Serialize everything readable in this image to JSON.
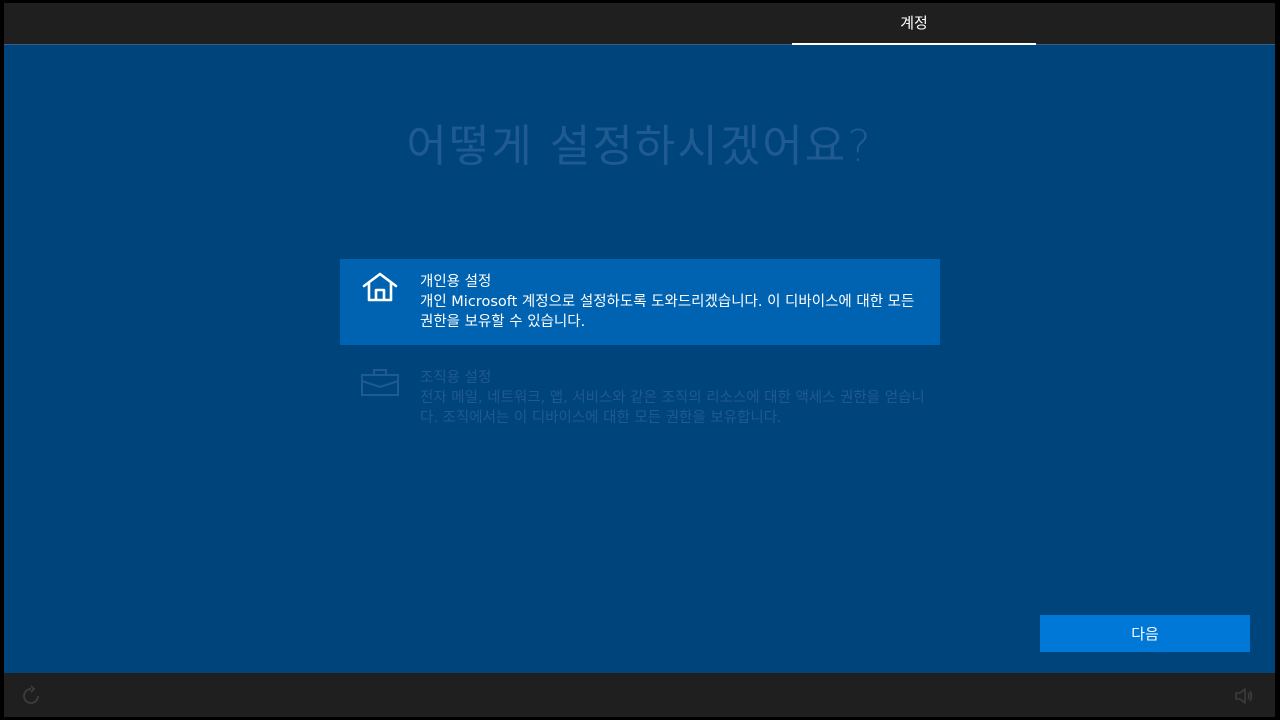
{
  "header": {
    "active_tab": "계정"
  },
  "main": {
    "title": "어떻게 설정하시겠어요?",
    "options": [
      {
        "icon": "home-icon",
        "title": "개인용 설정",
        "description": "개인 Microsoft 계정으로 설정하도록 도와드리겠습니다. 이 디바이스에 대한 모든 권한을 보유할 수 있습니다.",
        "selected": true
      },
      {
        "icon": "briefcase-icon",
        "title": "조직용 설정",
        "description": "전자 메일, 네트워크, 앱, 서비스와 같은 조직의 리소스에 대한 액세스 권한을 얻습니다. 조직에서는 이 디바이스에 대한 모든 권한을 보유합니다.",
        "selected": false
      }
    ]
  },
  "footer": {
    "next_label": "다음",
    "left_icon": "ease-of-access-icon",
    "right_icon": "volume-icon"
  },
  "colors": {
    "background": "#00447c",
    "bar": "#1f1f1f",
    "selected_option": "#0063b1",
    "button": "#0078d7",
    "dim_text": "#1f5a90"
  }
}
